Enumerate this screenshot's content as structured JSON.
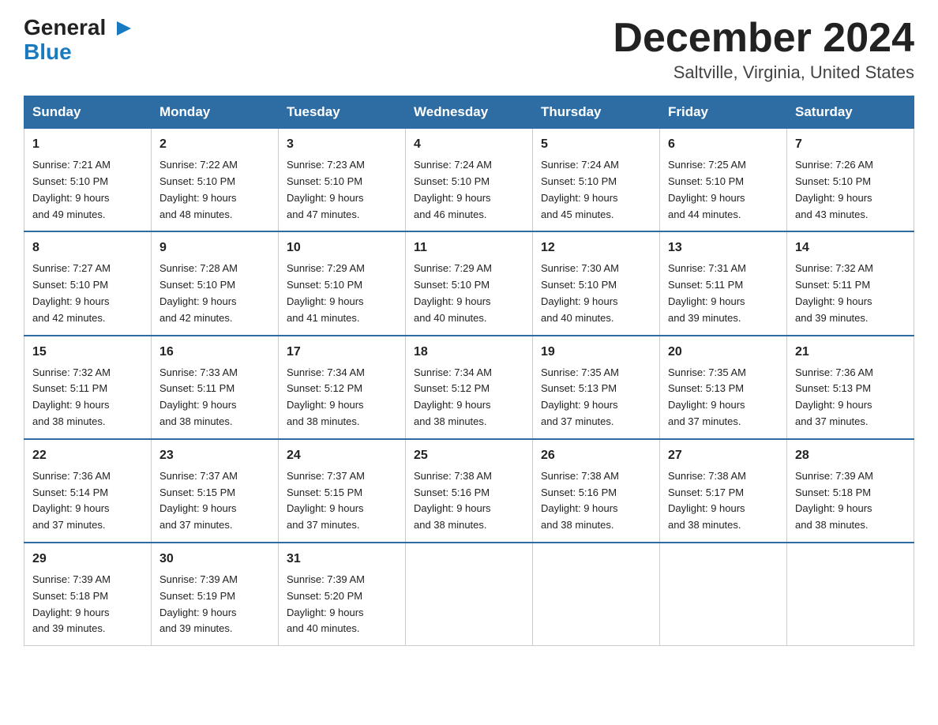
{
  "logo": {
    "general": "General",
    "blue": "Blue",
    "triangle": "▲"
  },
  "title": "December 2024",
  "location": "Saltville, Virginia, United States",
  "weekdays": [
    "Sunday",
    "Monday",
    "Tuesday",
    "Wednesday",
    "Thursday",
    "Friday",
    "Saturday"
  ],
  "weeks": [
    [
      {
        "day": "1",
        "sunrise": "7:21 AM",
        "sunset": "5:10 PM",
        "daylight": "9 hours and 49 minutes."
      },
      {
        "day": "2",
        "sunrise": "7:22 AM",
        "sunset": "5:10 PM",
        "daylight": "9 hours and 48 minutes."
      },
      {
        "day": "3",
        "sunrise": "7:23 AM",
        "sunset": "5:10 PM",
        "daylight": "9 hours and 47 minutes."
      },
      {
        "day": "4",
        "sunrise": "7:24 AM",
        "sunset": "5:10 PM",
        "daylight": "9 hours and 46 minutes."
      },
      {
        "day": "5",
        "sunrise": "7:24 AM",
        "sunset": "5:10 PM",
        "daylight": "9 hours and 45 minutes."
      },
      {
        "day": "6",
        "sunrise": "7:25 AM",
        "sunset": "5:10 PM",
        "daylight": "9 hours and 44 minutes."
      },
      {
        "day": "7",
        "sunrise": "7:26 AM",
        "sunset": "5:10 PM",
        "daylight": "9 hours and 43 minutes."
      }
    ],
    [
      {
        "day": "8",
        "sunrise": "7:27 AM",
        "sunset": "5:10 PM",
        "daylight": "9 hours and 42 minutes."
      },
      {
        "day": "9",
        "sunrise": "7:28 AM",
        "sunset": "5:10 PM",
        "daylight": "9 hours and 42 minutes."
      },
      {
        "day": "10",
        "sunrise": "7:29 AM",
        "sunset": "5:10 PM",
        "daylight": "9 hours and 41 minutes."
      },
      {
        "day": "11",
        "sunrise": "7:29 AM",
        "sunset": "5:10 PM",
        "daylight": "9 hours and 40 minutes."
      },
      {
        "day": "12",
        "sunrise": "7:30 AM",
        "sunset": "5:10 PM",
        "daylight": "9 hours and 40 minutes."
      },
      {
        "day": "13",
        "sunrise": "7:31 AM",
        "sunset": "5:11 PM",
        "daylight": "9 hours and 39 minutes."
      },
      {
        "day": "14",
        "sunrise": "7:32 AM",
        "sunset": "5:11 PM",
        "daylight": "9 hours and 39 minutes."
      }
    ],
    [
      {
        "day": "15",
        "sunrise": "7:32 AM",
        "sunset": "5:11 PM",
        "daylight": "9 hours and 38 minutes."
      },
      {
        "day": "16",
        "sunrise": "7:33 AM",
        "sunset": "5:11 PM",
        "daylight": "9 hours and 38 minutes."
      },
      {
        "day": "17",
        "sunrise": "7:34 AM",
        "sunset": "5:12 PM",
        "daylight": "9 hours and 38 minutes."
      },
      {
        "day": "18",
        "sunrise": "7:34 AM",
        "sunset": "5:12 PM",
        "daylight": "9 hours and 38 minutes."
      },
      {
        "day": "19",
        "sunrise": "7:35 AM",
        "sunset": "5:13 PM",
        "daylight": "9 hours and 37 minutes."
      },
      {
        "day": "20",
        "sunrise": "7:35 AM",
        "sunset": "5:13 PM",
        "daylight": "9 hours and 37 minutes."
      },
      {
        "day": "21",
        "sunrise": "7:36 AM",
        "sunset": "5:13 PM",
        "daylight": "9 hours and 37 minutes."
      }
    ],
    [
      {
        "day": "22",
        "sunrise": "7:36 AM",
        "sunset": "5:14 PM",
        "daylight": "9 hours and 37 minutes."
      },
      {
        "day": "23",
        "sunrise": "7:37 AM",
        "sunset": "5:15 PM",
        "daylight": "9 hours and 37 minutes."
      },
      {
        "day": "24",
        "sunrise": "7:37 AM",
        "sunset": "5:15 PM",
        "daylight": "9 hours and 37 minutes."
      },
      {
        "day": "25",
        "sunrise": "7:38 AM",
        "sunset": "5:16 PM",
        "daylight": "9 hours and 38 minutes."
      },
      {
        "day": "26",
        "sunrise": "7:38 AM",
        "sunset": "5:16 PM",
        "daylight": "9 hours and 38 minutes."
      },
      {
        "day": "27",
        "sunrise": "7:38 AM",
        "sunset": "5:17 PM",
        "daylight": "9 hours and 38 minutes."
      },
      {
        "day": "28",
        "sunrise": "7:39 AM",
        "sunset": "5:18 PM",
        "daylight": "9 hours and 38 minutes."
      }
    ],
    [
      {
        "day": "29",
        "sunrise": "7:39 AM",
        "sunset": "5:18 PM",
        "daylight": "9 hours and 39 minutes."
      },
      {
        "day": "30",
        "sunrise": "7:39 AM",
        "sunset": "5:19 PM",
        "daylight": "9 hours and 39 minutes."
      },
      {
        "day": "31",
        "sunrise": "7:39 AM",
        "sunset": "5:20 PM",
        "daylight": "9 hours and 40 minutes."
      },
      null,
      null,
      null,
      null
    ]
  ],
  "labels": {
    "sunrise": "Sunrise:",
    "sunset": "Sunset:",
    "daylight": "Daylight:"
  }
}
